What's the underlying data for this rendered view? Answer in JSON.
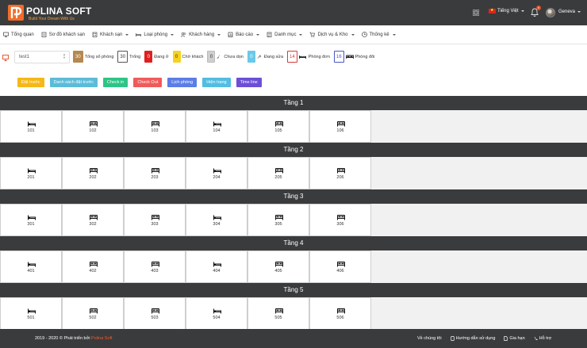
{
  "header": {
    "brand": "POLINA SOFT",
    "tagline": "Build Your Dream With Us",
    "language": "Tiếng Việt",
    "notification_count": "9",
    "user": "Geneva"
  },
  "nav": [
    {
      "label": "Tổng quan",
      "icon": "monitor-icon",
      "has_caret": false
    },
    {
      "label": "Sơ đồ khách sạn",
      "icon": "map-icon",
      "has_caret": false
    },
    {
      "label": "Khách sạn",
      "icon": "building-icon",
      "has_caret": true
    },
    {
      "label": "Loại phòng",
      "icon": "bed-icon",
      "has_caret": true
    },
    {
      "label": "Khách hàng",
      "icon": "users-icon",
      "has_caret": true
    },
    {
      "label": "Báo cáo",
      "icon": "chart-icon",
      "has_caret": true
    },
    {
      "label": "Danh mục",
      "icon": "list-icon",
      "has_caret": true
    },
    {
      "label": "Dịch vụ & Kho",
      "icon": "cart-icon",
      "has_caret": true
    },
    {
      "label": "Thống kê",
      "icon": "clock-icon",
      "has_caret": true
    }
  ],
  "filter": {
    "hotel_select": "test1"
  },
  "stats": [
    {
      "count": "30",
      "label": "Tổng số phòng",
      "bg": "#b5884f",
      "fg": "#ffffff",
      "border": "#b5884f",
      "icon": null
    },
    {
      "count": "30",
      "label": "Trống",
      "bg": "#ffffff",
      "fg": "#333333",
      "border": "#555555",
      "icon": null
    },
    {
      "count": "0",
      "label": "Đang ở",
      "bg": "#e02020",
      "fg": "#ffffff",
      "border": "#e02020",
      "icon": null
    },
    {
      "count": "0",
      "label": "Chờ khách",
      "bg": "#f7d21e",
      "fg": "#333333",
      "border": "#f7d21e",
      "icon": null
    },
    {
      "count": "0",
      "label": "Chưa dọn",
      "bg": "#cfcfcf",
      "fg": "#333333",
      "border": "#bbbbbb",
      "icon": "broom-icon"
    },
    {
      "count": "0",
      "label": "Đang sửa",
      "bg": "#6ac8e8",
      "fg": "#ffffff",
      "border": "#6ac8e8",
      "icon": "wrench-icon"
    },
    {
      "count": "14",
      "label": "Phòng đơn",
      "bg": "#ffffff",
      "fg": "#d83a3a",
      "border": "#d83a3a",
      "icon": "single-bed-icon"
    },
    {
      "count": "16",
      "label": "Phòng đôi",
      "bg": "#ffffff",
      "fg": "#4a55c5",
      "border": "#4a55c5",
      "icon": "double-bed-icon"
    }
  ],
  "actions": [
    {
      "label": "Đặt trước",
      "color": "#f5b81a",
      "name": "booking-button"
    },
    {
      "label": "Danh sách đặt trước",
      "color": "#5bbcd8",
      "name": "booking-list-button"
    },
    {
      "label": "Check in",
      "color": "#2ec486",
      "name": "check-in-button"
    },
    {
      "label": "Check Out",
      "color": "#ef5b5b",
      "name": "check-out-button"
    },
    {
      "label": "Lịch phòng",
      "color": "#5c7de6",
      "name": "room-calendar-button"
    },
    {
      "label": "Hiện trạng",
      "color": "#52bde0",
      "name": "status-button"
    },
    {
      "label": "Time line",
      "color": "#6d4fd6",
      "name": "timeline-button"
    }
  ],
  "floors": [
    {
      "label": "Tầng 1",
      "rooms": [
        "101",
        "102",
        "103",
        "104",
        "105",
        "106"
      ],
      "types": [
        "single",
        "double",
        "double",
        "single",
        "double",
        "double"
      ]
    },
    {
      "label": "Tầng 2",
      "rooms": [
        "201",
        "202",
        "203",
        "204",
        "205",
        "206"
      ],
      "types": [
        "single",
        "double",
        "double",
        "single",
        "double",
        "double"
      ]
    },
    {
      "label": "Tầng 3",
      "rooms": [
        "301",
        "302",
        "303",
        "304",
        "305",
        "306"
      ],
      "types": [
        "single",
        "double",
        "double",
        "single",
        "double",
        "double"
      ]
    },
    {
      "label": "Tầng 4",
      "rooms": [
        "401",
        "402",
        "403",
        "404",
        "405",
        "406"
      ],
      "types": [
        "single",
        "double",
        "double",
        "single",
        "double",
        "double"
      ]
    },
    {
      "label": "Tầng 5",
      "rooms": [
        "501",
        "502",
        "503",
        "504",
        "505",
        "506"
      ],
      "types": [
        "single",
        "double",
        "double",
        "single",
        "double",
        "double"
      ]
    }
  ],
  "footer": {
    "copyright": "2019 - 2020 © Phát triển bởi",
    "company": "Polina Soft",
    "links": [
      {
        "label": "Về chúng tôi",
        "icon": null
      },
      {
        "label": "Hướng dẫn sử dụng",
        "icon": "phone-icon"
      },
      {
        "label": "Gia hạn",
        "icon": "doc-icon"
      },
      {
        "label": "Hỗ trợ",
        "icon": "support-icon"
      }
    ]
  },
  "colors": {
    "dark": "#3a3b3d",
    "accent": "#f25c27"
  }
}
